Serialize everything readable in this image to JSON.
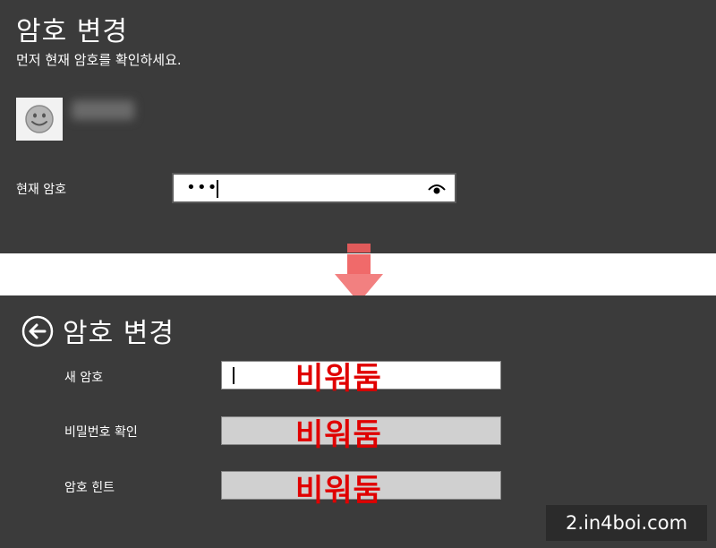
{
  "top_panel": {
    "title": "암호 변경",
    "subtitle": "먼저 현재 암호를 확인하세요.",
    "avatar_icon": "smiley-face-icon",
    "current_password_label": "현재 암호",
    "current_password_value": "•••",
    "reveal_icon": "eye-icon"
  },
  "divider": {
    "arrow_icon": "down-arrow-icon",
    "arrow_color": "#f06a6a"
  },
  "bottom_panel": {
    "back_icon": "back-arrow-icon",
    "title": "암호 변경",
    "new_password_label": "새 암호",
    "confirm_password_label": "비밀번호 확인",
    "hint_label": "암호 힌트",
    "annotation_1": "비워둠",
    "annotation_2": "비워둠",
    "annotation_3": "비워둠",
    "annotation_color": "#e00000"
  },
  "watermark": "2.in4boi.com"
}
